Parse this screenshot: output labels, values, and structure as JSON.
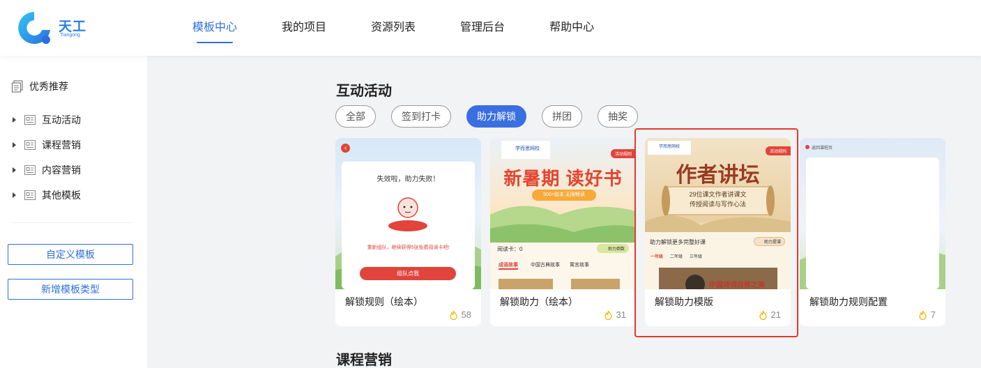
{
  "brand": {
    "name_cn": "天工",
    "name_en": "Tiangong",
    "color": "#2a7de1"
  },
  "nav": {
    "items": [
      "模板中心",
      "我的项目",
      "资源列表",
      "管理后台",
      "帮助中心"
    ],
    "active_index": 0,
    "accent": "#2f6fde"
  },
  "sidebar": {
    "header": "优秀推荐",
    "items": [
      {
        "label": "互动活动"
      },
      {
        "label": "课程营销"
      },
      {
        "label": "内容营销"
      },
      {
        "label": "其他模板"
      }
    ],
    "custom_template_button": "自定义模板",
    "add_type_button": "新增模板类型"
  },
  "main": {
    "section1_title": "互动活动",
    "filters": [
      "全部",
      "签到打卡",
      "助力解锁",
      "拼团",
      "抽奖"
    ],
    "active_filter_index": 2,
    "cards": [
      {
        "title": "解锁规则（绘本）",
        "count": "58",
        "thumb": {
          "modal_title": "失效啦，助力失败！",
          "modal_text": "重新组队，继续获得5张免费阅读卡吧!",
          "modal_button": "组队点我"
        }
      },
      {
        "title": "解锁助力（绘本）",
        "count": "31",
        "thumb": {
          "brand": "学而思网校",
          "rule_tag": "活动规则",
          "headline": "新暑期 读好书",
          "sub": "500+绘本  无限畅读",
          "card_label": "阅读卡：0",
          "help_btn": "助力倒数",
          "tabs": [
            "成语故事",
            "中国古典故事",
            "寓言故事"
          ]
        }
      },
      {
        "title": "解锁助力模版",
        "count": "21",
        "thumb": {
          "brand": "学而思网校",
          "rule_tag": "活动规则",
          "headline": "作者讲坛",
          "scroll_line1": "29位课文作者讲课文",
          "scroll_line2": "传授阅读与写作心法",
          "caption": "助力解锁更多完整好课",
          "help_btn": "助力提课",
          "tabs": [
            "一年级",
            "二年级",
            "三年级"
          ],
          "video_text": "中国诗词自修之美"
        }
      },
      {
        "title": "解锁助力规则配置",
        "count": "7",
        "thumb": {
          "back_text": "返回课程页"
        }
      }
    ],
    "section2_title": "课程营销"
  },
  "colors": {
    "highlight_border": "#e23a2a",
    "flame_icon": "#f5b800",
    "primary_chip": "#3a6fe2"
  }
}
